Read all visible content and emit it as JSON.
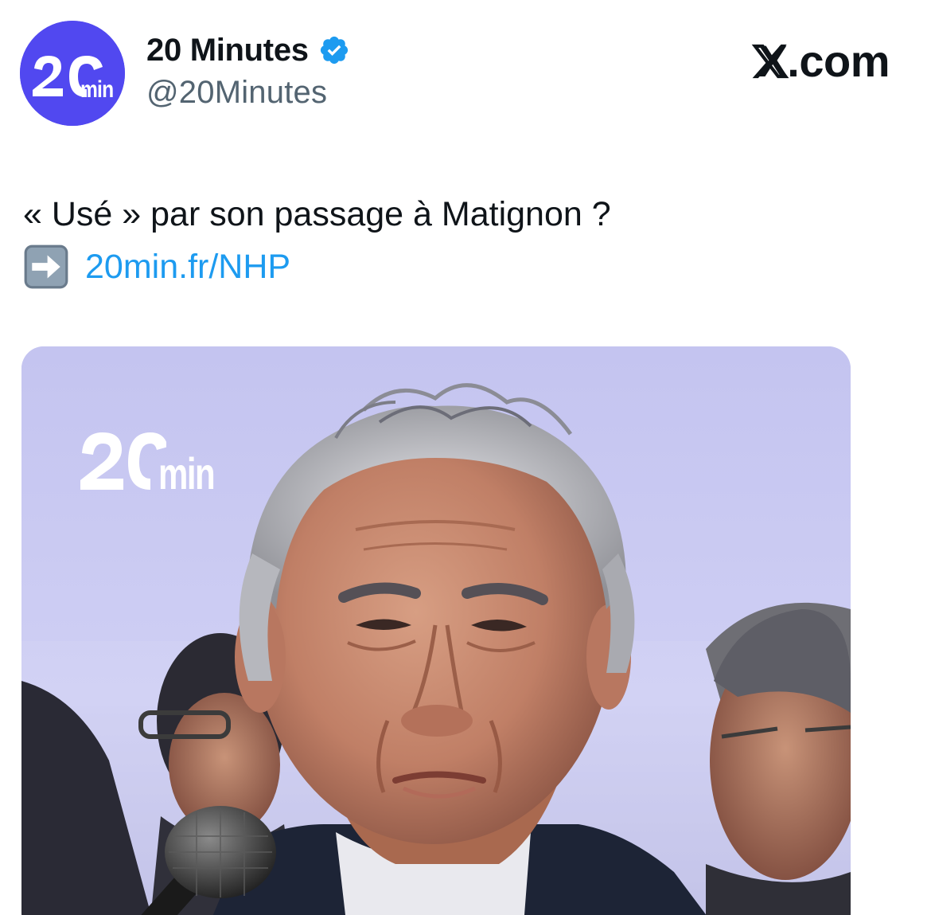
{
  "account": {
    "display_name": "20 Minutes",
    "handle": "@20Minutes",
    "avatar_text": "20min",
    "verified": true
  },
  "brand": {
    "site": "X.com"
  },
  "tweet": {
    "text_line1": "« Usé » par son passage à Matignon ?",
    "emoji": "right-arrow-emoji",
    "link_text": "20min.fr/NHP"
  },
  "media": {
    "watermark_text": "20min"
  },
  "colors": {
    "avatar_bg": "#5148f0",
    "verified_blue": "#1d9bf0",
    "link_blue": "#1d9bf0",
    "text_primary": "#0f1419",
    "text_secondary": "#536471",
    "photo_background": "#c7c7f1"
  },
  "icons": {
    "verified": "verified-badge-icon",
    "x_logo": "x-logo-icon",
    "arrow": "right-arrow-emoji"
  }
}
